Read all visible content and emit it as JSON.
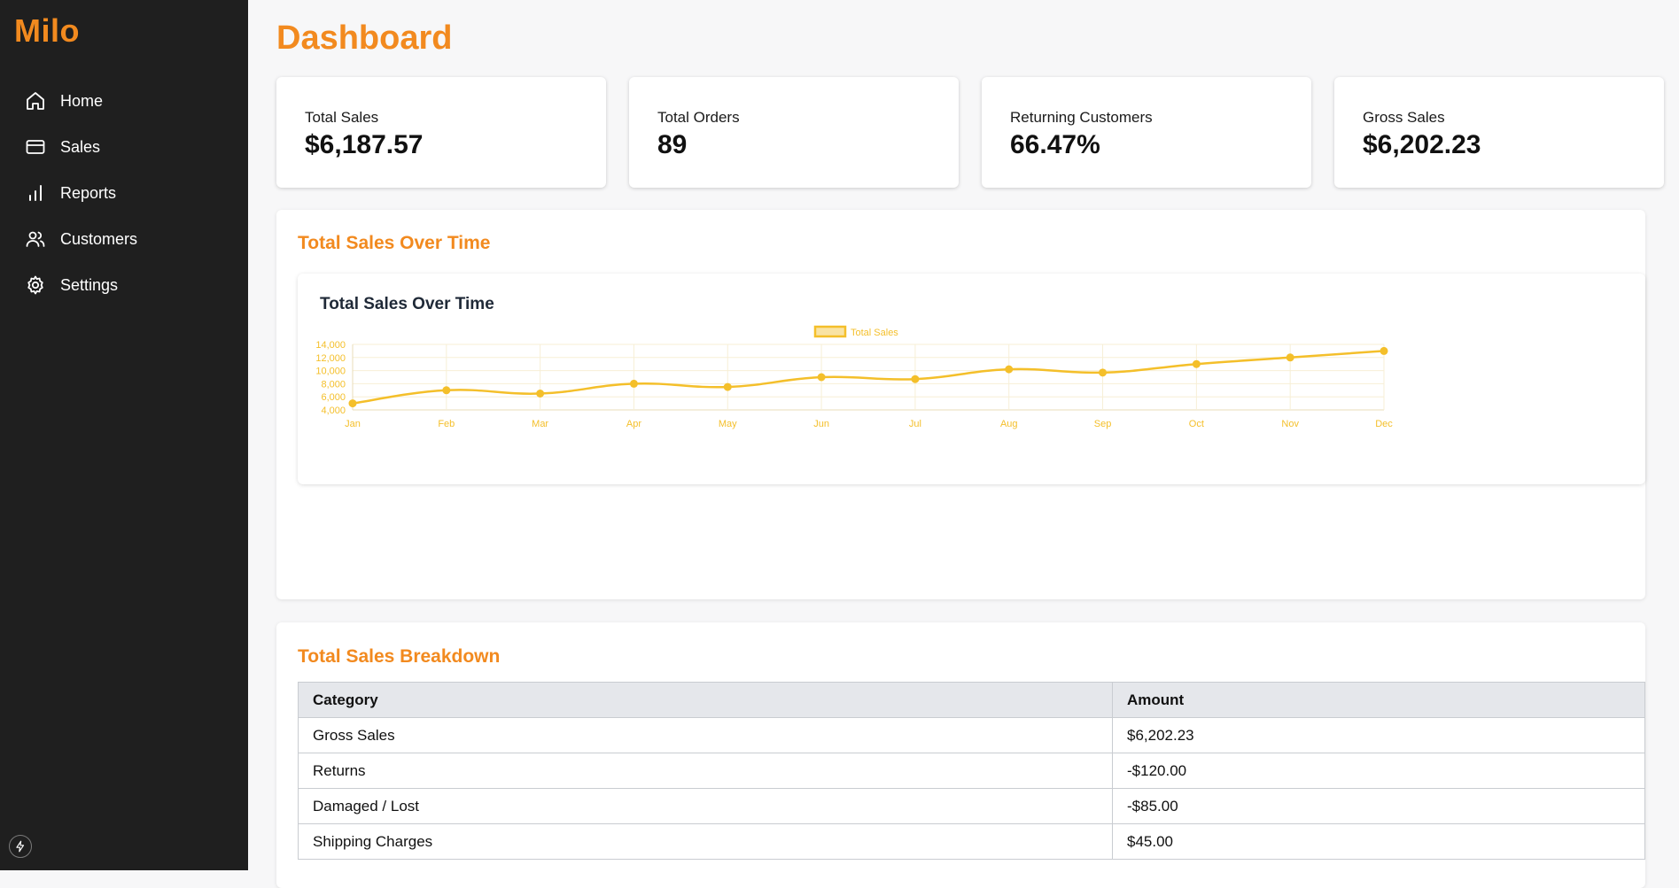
{
  "app": {
    "name": "Milo"
  },
  "sidebar": {
    "items": [
      {
        "label": "Home",
        "icon": "home-icon"
      },
      {
        "label": "Sales",
        "icon": "credit-card-icon"
      },
      {
        "label": "Reports",
        "icon": "bar-chart-icon"
      },
      {
        "label": "Customers",
        "icon": "users-icon"
      },
      {
        "label": "Settings",
        "icon": "gear-icon"
      }
    ],
    "footer_icon": "bolt-icon"
  },
  "header": {
    "title": "Dashboard"
  },
  "stats": [
    {
      "label": "Total Sales",
      "value": "$6,187.57"
    },
    {
      "label": "Total Orders",
      "value": "89"
    },
    {
      "label": "Returning Customers",
      "value": "66.47%"
    },
    {
      "label": "Gross Sales",
      "value": "$6,202.23"
    }
  ],
  "sales_panel": {
    "title": "Total Sales Over Time"
  },
  "chart_data": {
    "type": "line",
    "title": "Total Sales Over Time",
    "categories": [
      "Jan",
      "Feb",
      "Mar",
      "Apr",
      "May",
      "Jun",
      "Jul",
      "Aug",
      "Sep",
      "Oct",
      "Nov",
      "Dec"
    ],
    "series": [
      {
        "name": "Total Sales",
        "values": [
          5000,
          7000,
          6500,
          8000,
          7500,
          9000,
          8700,
          10200,
          9700,
          11000,
          12000,
          13000
        ]
      }
    ],
    "yticks": [
      "14,000",
      "12,000",
      "10,000",
      "8,000",
      "6,000",
      "4,000"
    ],
    "ylim": [
      4000,
      14000
    ],
    "xlabel": "",
    "ylabel": "",
    "legend": "top-center",
    "grid": true,
    "color": "#f4bf2a"
  },
  "breakdown": {
    "title": "Total Sales Breakdown",
    "headers": [
      "Category",
      "Amount"
    ],
    "rows": [
      [
        "Gross Sales",
        "$6,202.23"
      ],
      [
        "Returns",
        "-$120.00"
      ],
      [
        "Damaged / Lost",
        "-$85.00"
      ],
      [
        "Shipping Charges",
        "$45.00"
      ]
    ]
  },
  "colors": {
    "accent": "#f28a1f",
    "sidebar_bg": "#1f1f1f",
    "chart_line": "#f4bf2a"
  }
}
